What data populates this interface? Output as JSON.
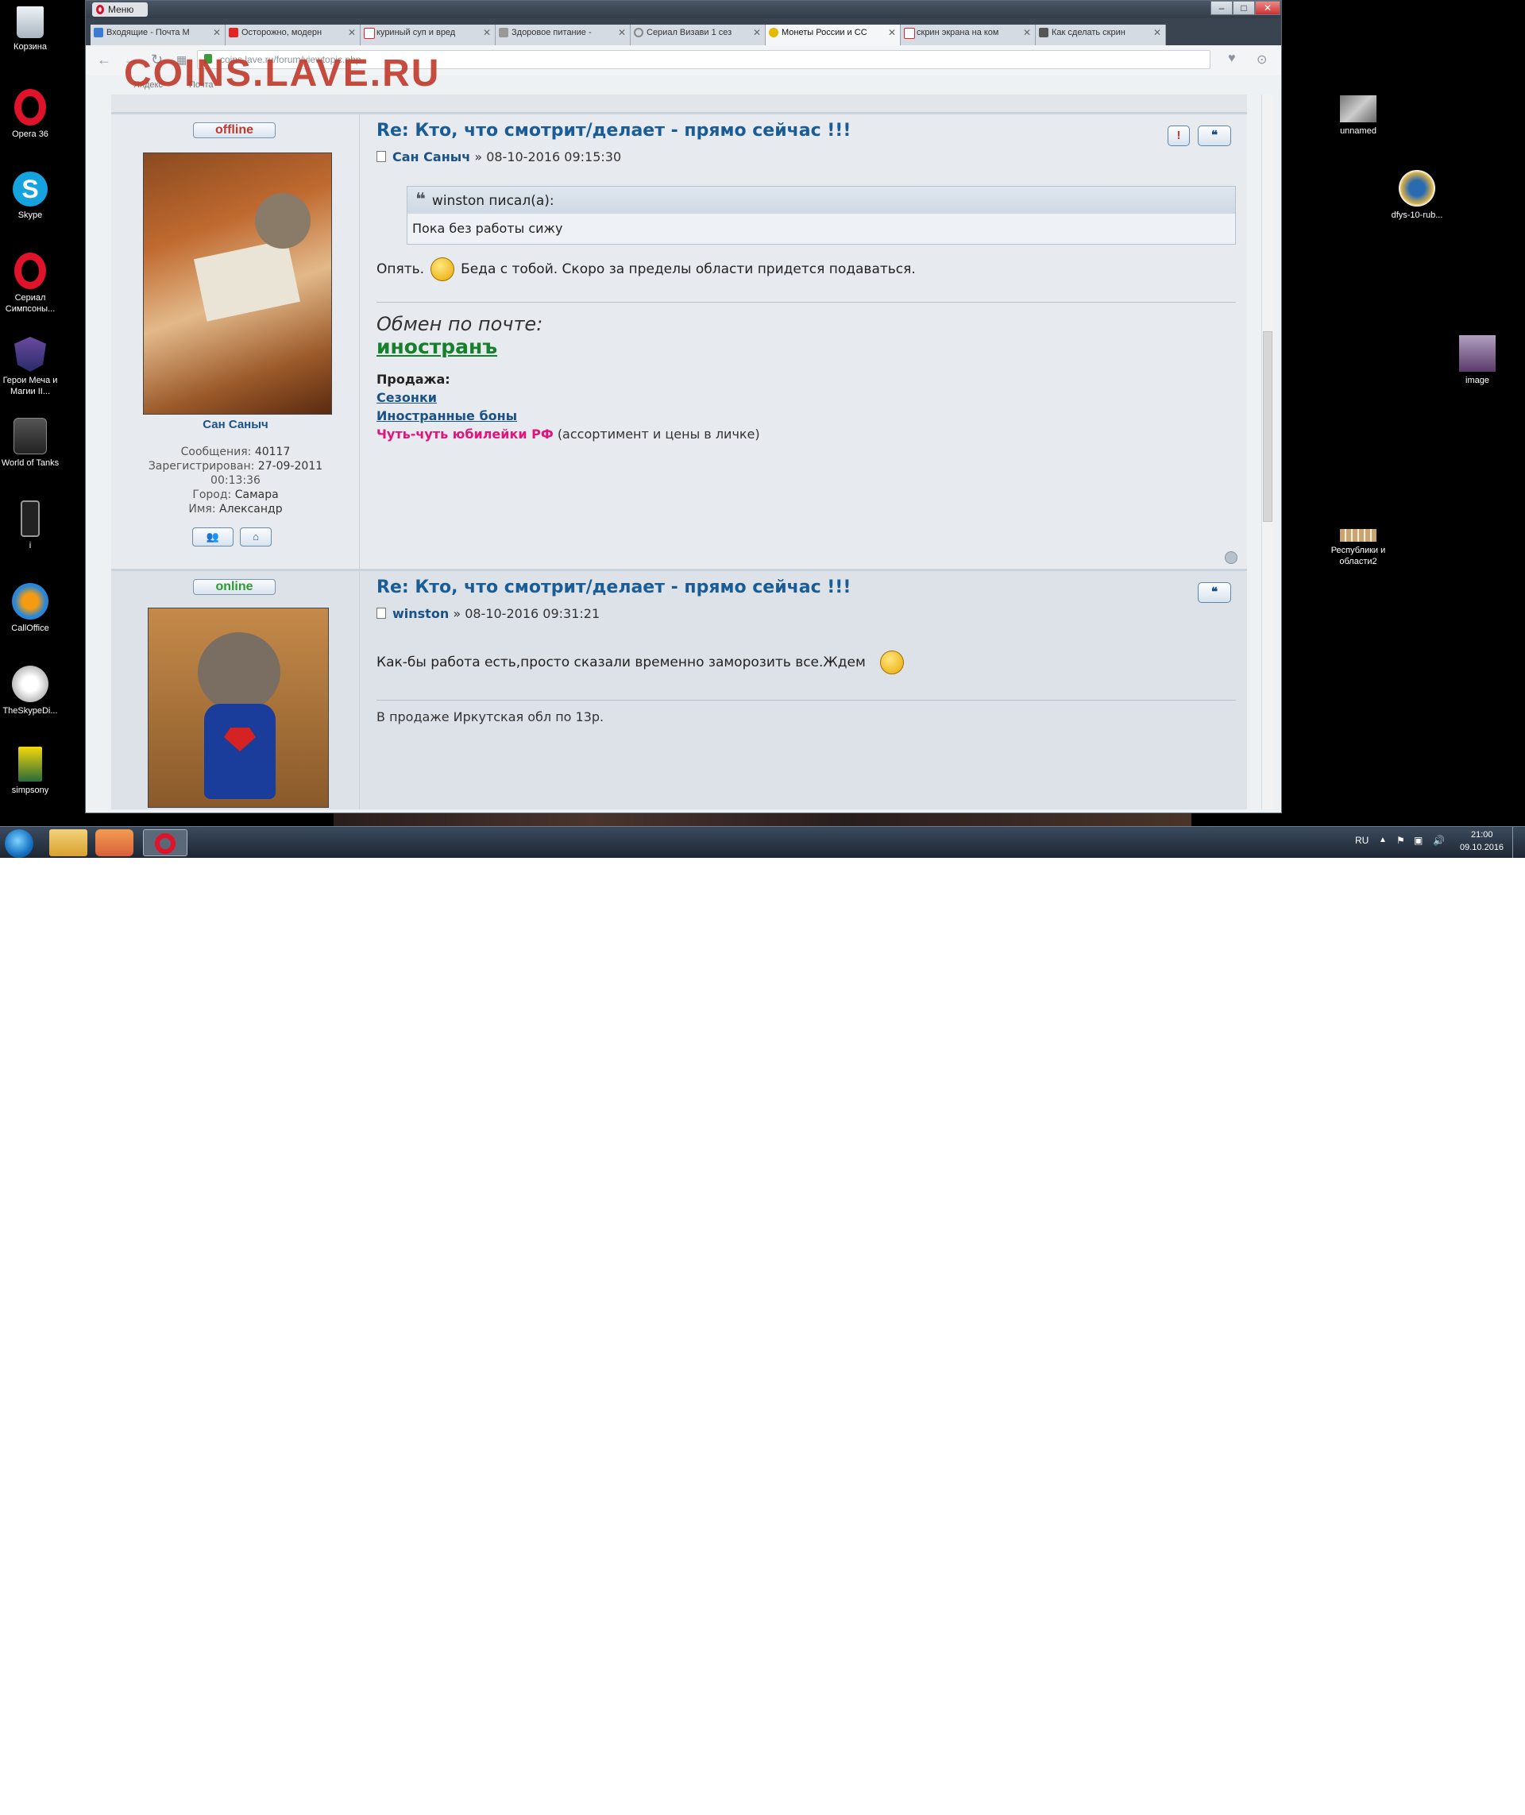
{
  "watermark": "COINS.LAVE.RU",
  "desktop": {
    "left_icons": [
      {
        "label": "Корзина",
        "icon": "recycle-bin-icon"
      },
      {
        "label": "Opera 36",
        "icon": "opera-icon"
      },
      {
        "label": "Skype",
        "icon": "skype-icon"
      },
      {
        "label": "Сериал Симпсоны...",
        "icon": "opera-icon"
      },
      {
        "label": "Герои Меча и Магии II...",
        "icon": "heroes-icon"
      },
      {
        "label": "World of Tanks",
        "icon": "world-of-tanks-icon"
      },
      {
        "label": "i",
        "icon": "phone-icon"
      },
      {
        "label": "CallOffice",
        "icon": "calloffice-icon"
      },
      {
        "label": "TheSkypeDi...",
        "icon": "skype-dialer-icon"
      },
      {
        "label": "simpsony",
        "icon": "simpsons-icon"
      }
    ],
    "right_icons": [
      {
        "label": "unnamed",
        "icon": "image-thumbnail-icon"
      },
      {
        "label": "dfys-10-rub...",
        "icon": "coin-thumbnail-icon"
      },
      {
        "label": "image",
        "icon": "image-thumbnail-icon"
      },
      {
        "label": "Республики и области2",
        "icon": "coins-thumbnail-icon"
      }
    ]
  },
  "browser": {
    "menu_label": "Меню",
    "window_buttons": [
      "–",
      "□",
      "✕"
    ],
    "tabs": [
      {
        "title": "Входящие - Почта М",
        "icon": "mail-icon",
        "color": "#3b7bd4"
      },
      {
        "title": "Осторожно, модерн",
        "icon": "youtube-icon",
        "color": "#e32424"
      },
      {
        "title": "куриный суп и вред",
        "icon": "yandex-icon",
        "color": "#e32424"
      },
      {
        "title": "Здоровое питание -",
        "icon": "spoon-icon",
        "color": "#666666"
      },
      {
        "title": "Сериал Визави 1 сез",
        "icon": "loading-icon",
        "color": "#888888"
      },
      {
        "title": "Монеты России и СС",
        "icon": "smiley-icon",
        "color": "#e6b800"
      },
      {
        "title": "скрин экрана на ком",
        "icon": "yandex-icon",
        "color": "#e32424"
      },
      {
        "title": "Как сделать скрин",
        "icon": "screen-icon",
        "color": "#555555"
      }
    ],
    "new_tab": "+",
    "url": "coins.lave.ru/forum/viewtopic.php",
    "bookmarks": [
      "Яндекс",
      "Почта"
    ]
  },
  "forum": {
    "post1": {
      "status": "offline",
      "username": "Сан Саныч",
      "messages_label": "Сообщения:",
      "messages": "40117",
      "registered_label": "Зарегистрирован:",
      "registered": "27-09-2011",
      "registered_time": "00:13:36",
      "city_label": "Город:",
      "city": "Самара",
      "name_label": "Имя:",
      "name": "Александр",
      "title": "Re: Кто, что смотрит/делает - прямо сейчас !!!",
      "author": "Сан Саныч",
      "datetime": "» 08-10-2016 09:15:30",
      "quote_author": "winston писал(а):",
      "quote_text": "Пока без работы сижу",
      "text_before": "Опять.",
      "text_after": "Беда с тобой. Скоро за пределы области придется подаваться.",
      "sig_exchange": "Обмен по почте:",
      "sig_link": "иностранъ",
      "sig_sale": "Продажа:",
      "sig_links": [
        "Сезонки",
        "Иностранные боны"
      ],
      "sig_pink": "Чуть-чуть юбилейки РФ",
      "sig_pink_note": "(ассортимент и цены в личке)"
    },
    "post2": {
      "status": "online",
      "title": "Re: Кто, что смотрит/делает - прямо сейчас !!!",
      "author": "winston",
      "datetime": "» 08-10-2016 09:31:21",
      "text": "Как-бы работа есть,просто сказали временно заморозить все.Ждем",
      "signature": "В продаже Иркутская обл по 13р."
    }
  },
  "taskbar": {
    "lang": "RU",
    "time": "21:00",
    "date": "09.10.2016"
  }
}
